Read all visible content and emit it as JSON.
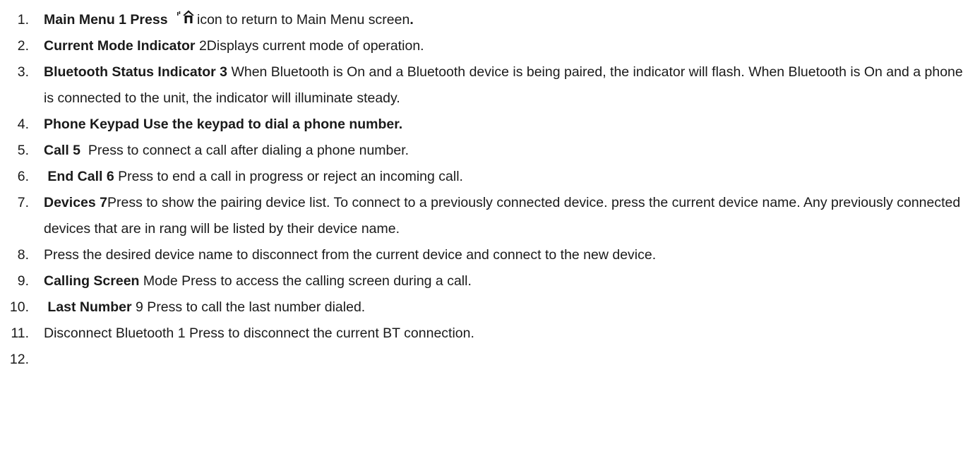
{
  "items": [
    {
      "number": "1",
      "label": "Main Menu 1 Press",
      "icon": "home-icon",
      "text": "icon to return to Main Menu screen",
      "tail": "."
    },
    {
      "number": "2",
      "label": "Current Mode Indicator",
      "text": "2Displays current mode of operation."
    },
    {
      "number": "3",
      "label": "Bluetooth Status Indicator 3",
      "text": "When Bluetooth is On and a Bluetooth device is being paired, the indicator will flash. When Bluetooth is On and a phone is connected to the unit, the indicator will illuminate steady."
    },
    {
      "number": "4",
      "label": "Phone Keypad Use the keypad to dial a phone number."
    },
    {
      "number": "5",
      "label": "Call 5",
      "text": " Press to connect a call after dialing a phone number."
    },
    {
      "number": "6",
      "label": "End Call 6",
      "text": "Press to end a call in progress or reject an incoming call."
    },
    {
      "number": "7",
      "label": "Devices 7",
      "text": "Press to show the pairing device list. To connect to a previously connected device. press the current device name. Any previously connected devices that are in rang will be listed by their device name."
    },
    {
      "number": "8",
      "text": "Press the desired device name to disconnect from the current device and connect to the new device."
    },
    {
      "number": "9",
      "label": "Calling Screen",
      "text": "Mode Press to access the calling screen during a call."
    },
    {
      "number": "10",
      "label": "Last Number",
      "text": "9 Press to call the last number dialed."
    },
    {
      "number": "11",
      "text": "Disconnect Bluetooth 1 Press to disconnect the current BT connection."
    },
    {
      "number": "12",
      "text": ""
    }
  ],
  "colors": {
    "text": "#1a1a1a",
    "background": "#ffffff"
  }
}
